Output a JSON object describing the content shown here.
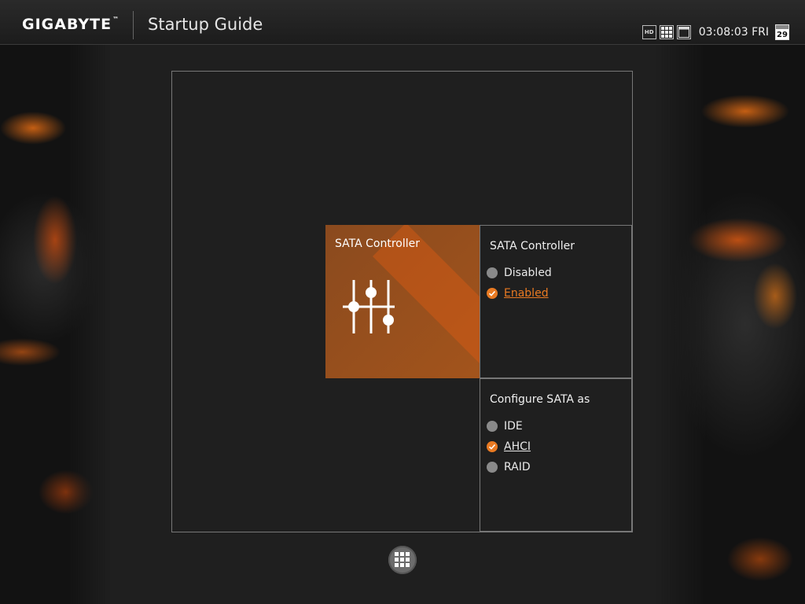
{
  "header": {
    "brand": "GIGABYTE",
    "brand_tm": "™",
    "app_title": "Startup Guide",
    "hd_label": "HD",
    "clock": "03:08:03 FRI",
    "calendar_day": "29"
  },
  "tile": {
    "title": "SATA Controller",
    "icon": "sliders-icon"
  },
  "sata_controller": {
    "title": "SATA Controller",
    "options": [
      {
        "label": "Disabled",
        "selected": false
      },
      {
        "label": "Enabled",
        "selected": true
      }
    ]
  },
  "configure_sata": {
    "title": "Configure SATA as",
    "options": [
      {
        "label": "IDE",
        "selected": false
      },
      {
        "label": "AHCI",
        "selected": true
      },
      {
        "label": "RAID",
        "selected": false
      }
    ]
  },
  "footer": {
    "home_icon": "grid-menu-icon"
  },
  "colors": {
    "accent": "#e97a22",
    "tile": "#9a501c",
    "background": "#1f1f1f"
  }
}
